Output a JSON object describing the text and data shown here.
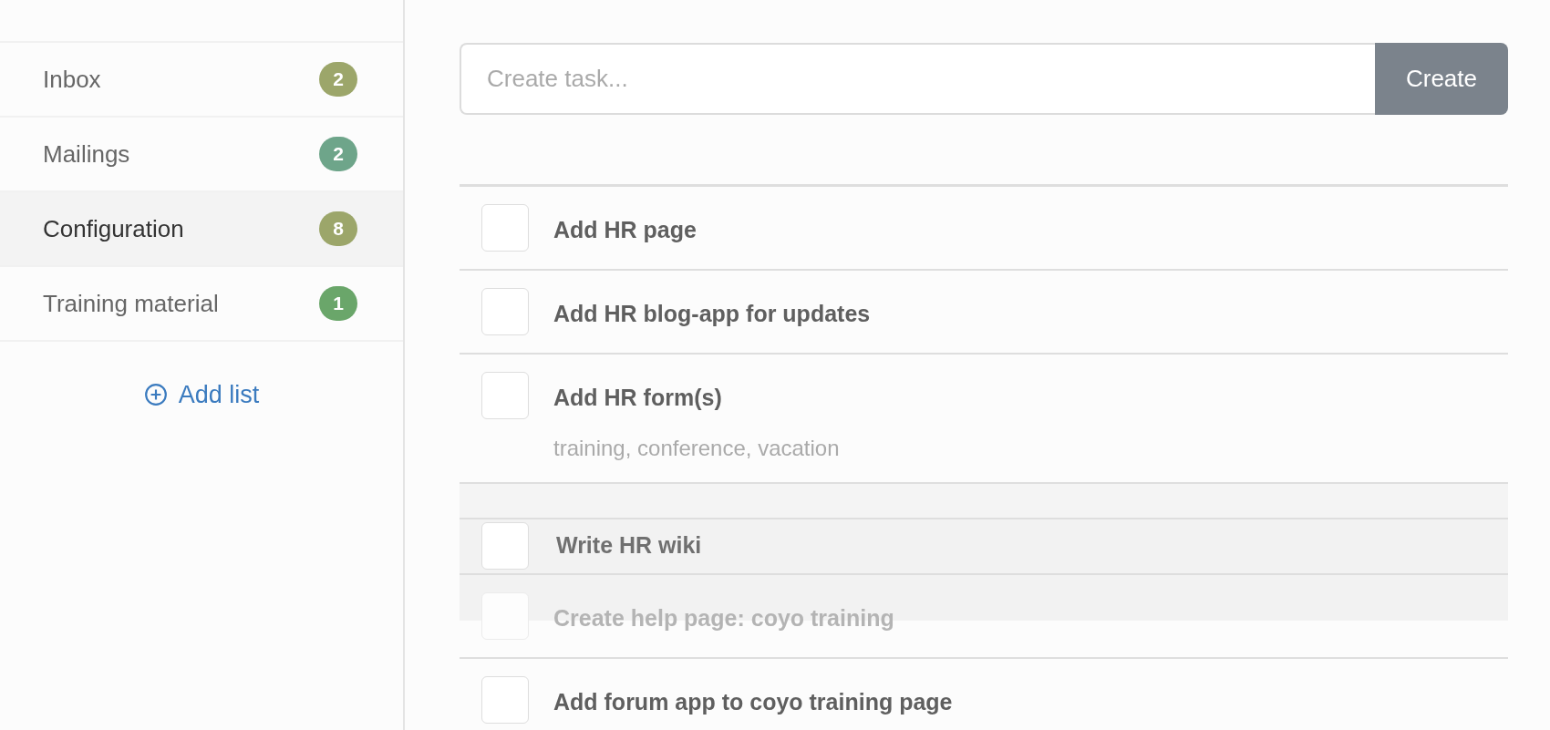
{
  "sidebar": {
    "items": [
      {
        "label": "Inbox",
        "count": "2",
        "color": "#9ca66a",
        "selected": false
      },
      {
        "label": "Mailings",
        "count": "2",
        "color": "#6ea58a",
        "selected": false
      },
      {
        "label": "Configuration",
        "count": "8",
        "color": "#9ca66a",
        "selected": true
      },
      {
        "label": "Training material",
        "count": "1",
        "color": "#6aa66a",
        "selected": false
      }
    ],
    "add_button": "Add list"
  },
  "task_form": {
    "placeholder": "Create task...",
    "button": "Create"
  },
  "tasks": [
    {
      "kind": "task",
      "title": "Add HR page",
      "checked": false
    },
    {
      "kind": "task",
      "title": "Add HR blog-app for updates",
      "checked": false
    },
    {
      "kind": "task",
      "title": "Add HR form(s)",
      "note": "training, conference, vacation",
      "checked": false
    },
    {
      "kind": "drop-slot"
    },
    {
      "kind": "task",
      "title": "Create help page: coyo training",
      "checked": false,
      "covered": true
    },
    {
      "kind": "task",
      "title": "Add forum app to coyo training page",
      "checked": false
    }
  ],
  "dragged_task": {
    "title": "Write HR wiki",
    "checked": false
  }
}
